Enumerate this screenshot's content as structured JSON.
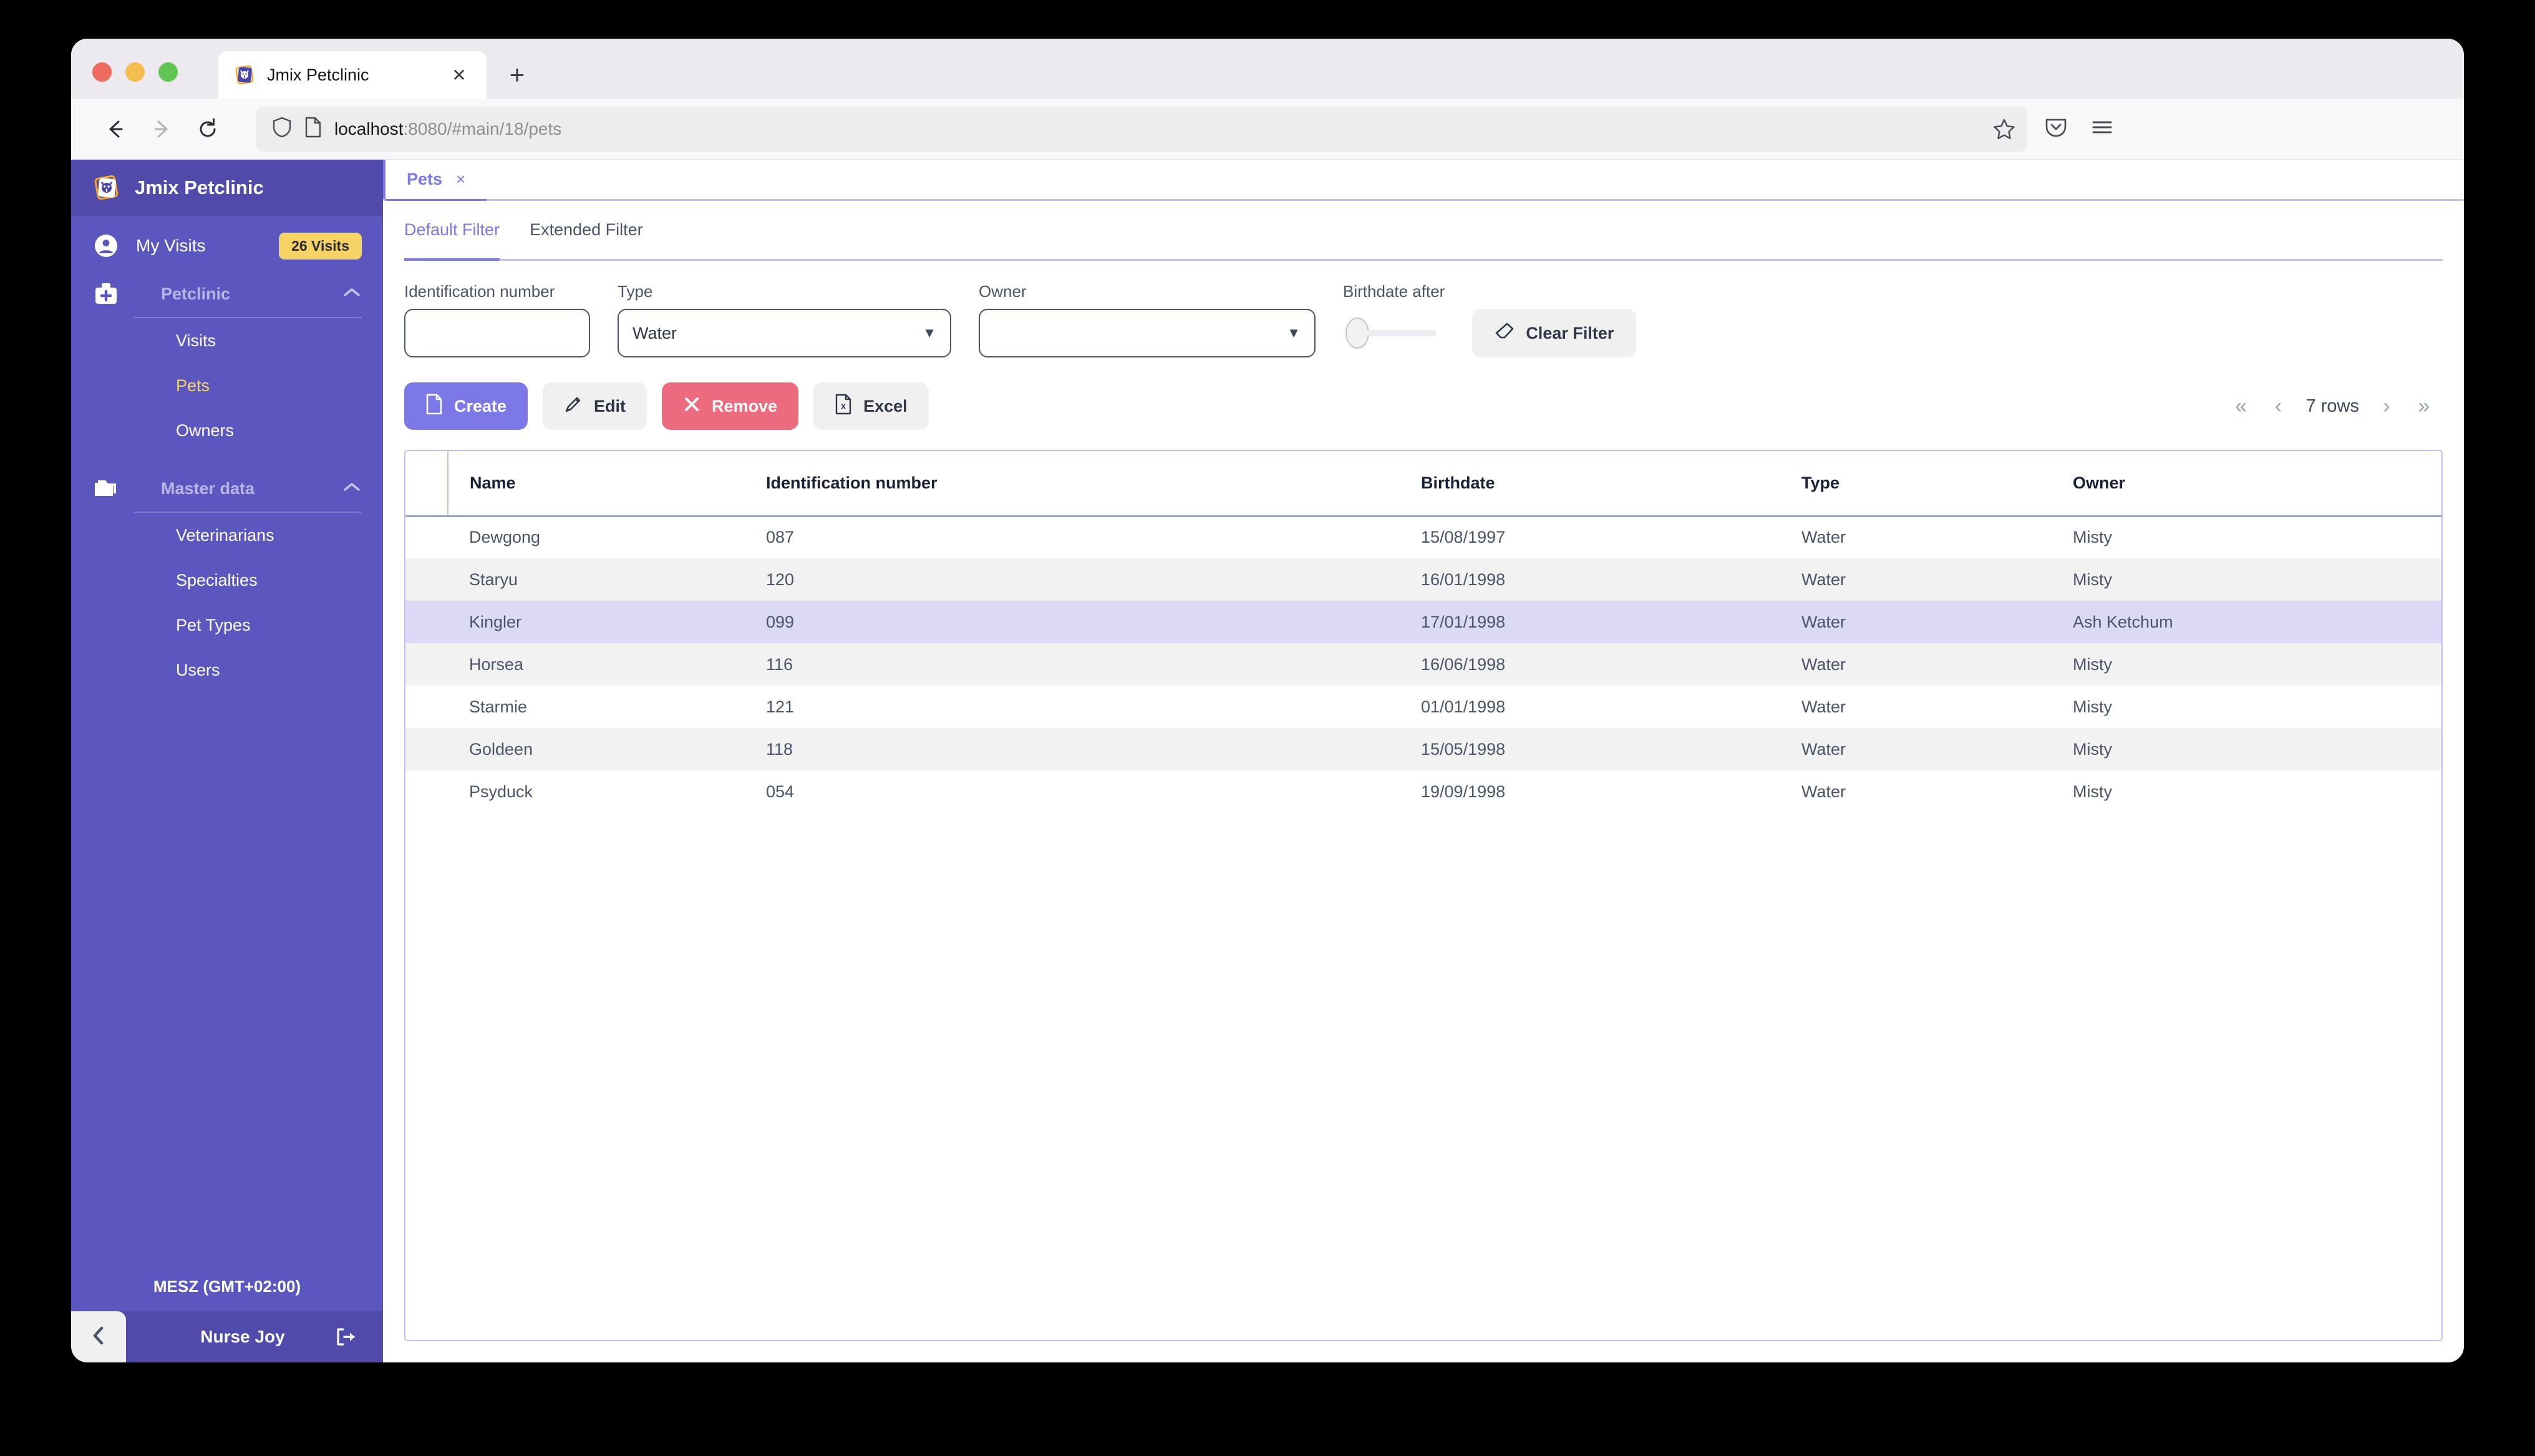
{
  "browser": {
    "tab": {
      "title": "Jmix Petclinic",
      "favicon": "petclinic-favicon",
      "close_label": "✕"
    },
    "new_tab_label": "+",
    "nav": {
      "back": "←",
      "forward": "→",
      "reload": "↻"
    },
    "url": {
      "host": "localhost",
      "rest": ":8080/#main/18/pets"
    },
    "icons": {
      "shield": "shield-icon",
      "page": "page-icon",
      "star": "bookmark-star-icon",
      "pocket": "pocket-icon",
      "menu": "hamburger-menu-icon"
    }
  },
  "sidebar": {
    "brand": "Jmix Petclinic",
    "my_visits": {
      "label": "My Visits",
      "badge": "26 Visits"
    },
    "groups": [
      {
        "title": "Petclinic",
        "icon": "medical-kit-icon",
        "items": [
          {
            "label": "Visits",
            "active": false
          },
          {
            "label": "Pets",
            "active": true
          },
          {
            "label": "Owners",
            "active": false
          }
        ]
      },
      {
        "title": "Master data",
        "icon": "folder-icon",
        "items": [
          {
            "label": "Veterinarians",
            "active": false
          },
          {
            "label": "Specialties",
            "active": false
          },
          {
            "label": "Pet Types",
            "active": false
          },
          {
            "label": "Users",
            "active": false
          }
        ]
      }
    ],
    "timezone": "MESZ (GMT+02:00)",
    "user": "Nurse Joy",
    "logout_icon": "logout-icon",
    "collapse_icon": "chevron-left-icon"
  },
  "app": {
    "tab": {
      "label": "Pets",
      "close": "×"
    },
    "filter_tabs": [
      {
        "label": "Default Filter",
        "active": true
      },
      {
        "label": "Extended Filter",
        "active": false
      }
    ],
    "filters": {
      "identification_number": {
        "label": "Identification number",
        "value": "",
        "placeholder": ""
      },
      "type": {
        "label": "Type",
        "value": "Water"
      },
      "owner": {
        "label": "Owner",
        "value": ""
      },
      "birthdate_after": {
        "label": "Birthdate after",
        "value": ""
      },
      "clear_button": {
        "label": "Clear Filter",
        "icon": "eraser-icon"
      }
    },
    "toolbar": {
      "create": {
        "label": "Create",
        "icon": "file-plus-icon"
      },
      "edit": {
        "label": "Edit",
        "icon": "pencil-icon"
      },
      "remove": {
        "label": "Remove",
        "icon": "cross-icon"
      },
      "excel": {
        "label": "Excel",
        "icon": "excel-file-icon"
      }
    },
    "pager": {
      "first": "«",
      "prev": "‹",
      "count": "7 rows",
      "next": "›",
      "last": "»"
    },
    "table": {
      "columns": [
        "Name",
        "Identification number",
        "Birthdate",
        "Type",
        "Owner"
      ],
      "rows": [
        {
          "name": "Dewgong",
          "ident": "087",
          "birthdate": "15/08/1997",
          "type": "Water",
          "owner": "Misty",
          "selected": false
        },
        {
          "name": "Staryu",
          "ident": "120",
          "birthdate": "16/01/1998",
          "type": "Water",
          "owner": "Misty",
          "selected": false
        },
        {
          "name": "Kingler",
          "ident": "099",
          "birthdate": "17/01/1998",
          "type": "Water",
          "owner": "Ash Ketchum",
          "selected": true
        },
        {
          "name": "Horsea",
          "ident": "116",
          "birthdate": "16/06/1998",
          "type": "Water",
          "owner": "Misty",
          "selected": false
        },
        {
          "name": "Starmie",
          "ident": "121",
          "birthdate": "01/01/1998",
          "type": "Water",
          "owner": "Misty",
          "selected": false
        },
        {
          "name": "Goldeen",
          "ident": "118",
          "birthdate": "15/05/1998",
          "type": "Water",
          "owner": "Misty",
          "selected": false
        },
        {
          "name": "Psyduck",
          "ident": "054",
          "birthdate": "19/09/1998",
          "type": "Water",
          "owner": "Misty",
          "selected": false
        }
      ]
    }
  },
  "colors": {
    "sidebar": "#5c57bf",
    "sidebar_dark": "#504aab",
    "accent": "#7d78e8",
    "danger": "#ec6b7e",
    "badge": "#f6d365",
    "row_selected": "#dcd9f7",
    "row_alt": "#f2f2f2"
  }
}
